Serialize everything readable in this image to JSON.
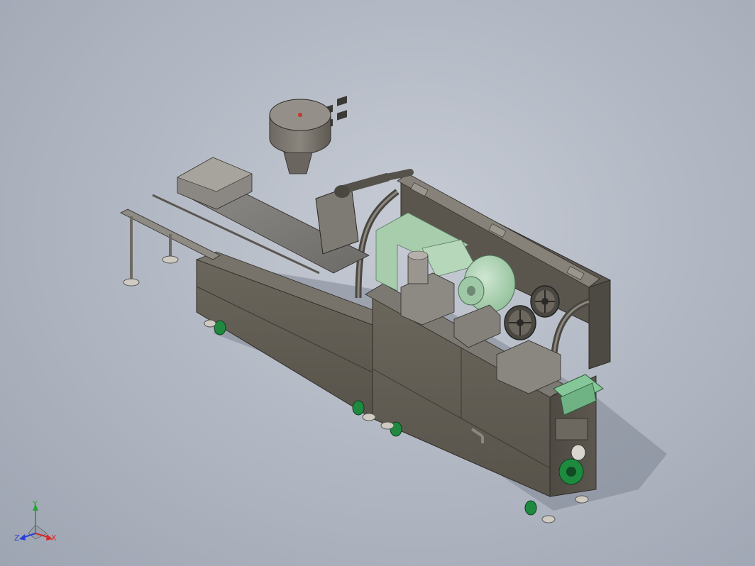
{
  "viewport": {
    "background_top": "#c6cbd5",
    "background_bottom": "#9ea5b2",
    "model": {
      "body_color": "#5f5a50",
      "frame_color": "#6f6b63",
      "film_color": "#a9cfae",
      "wheel_color": "#1f8a3f",
      "accent_red": "#c0392b"
    }
  },
  "triad": {
    "x_label": "X",
    "y_label": "Y",
    "z_label": "Z",
    "x_color": "#d62a2a",
    "y_color": "#2aa43a",
    "z_color": "#2a3fd6"
  }
}
